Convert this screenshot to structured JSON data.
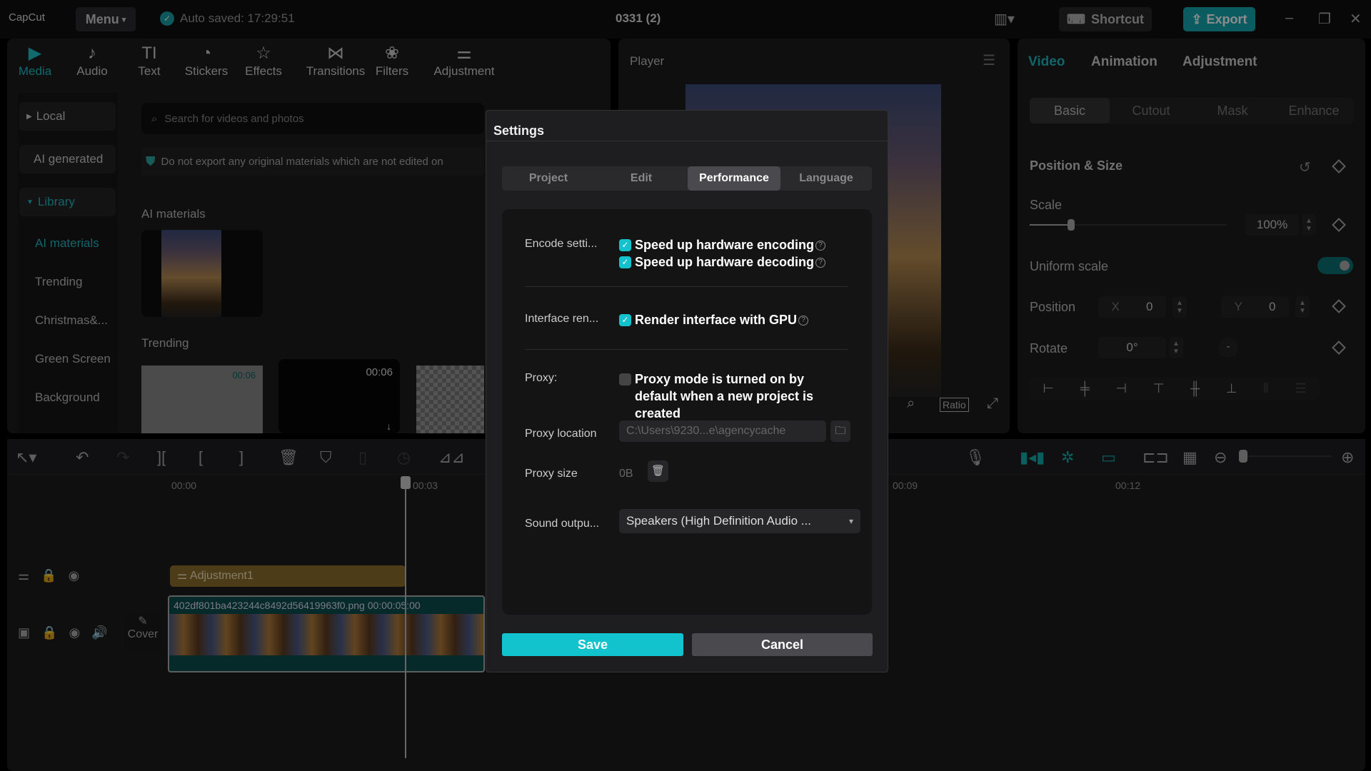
{
  "topbar": {
    "logo": "CapCut",
    "menu": "Menu",
    "autosave": "Auto saved: 17:29:51",
    "project_title": "0331 (2)",
    "shortcut": "Shortcut",
    "export": "Export"
  },
  "toolbar": {
    "tabs": [
      {
        "label": "Media",
        "icon": "▶"
      },
      {
        "label": "Audio",
        "icon": "♪"
      },
      {
        "label": "Text",
        "icon": "TI"
      },
      {
        "label": "Stickers",
        "icon": "◔"
      },
      {
        "label": "Effects",
        "icon": "☆"
      },
      {
        "label": "Transitions",
        "icon": "⋈"
      },
      {
        "label": "Filters",
        "icon": "❀"
      },
      {
        "label": "Adjustment",
        "icon": "⚌"
      }
    ]
  },
  "sidebar": {
    "local": "Local",
    "ai_generated": "AI generated",
    "library": "Library",
    "items": [
      "AI materials",
      "Trending",
      "Christmas&...",
      "Green Screen",
      "Background"
    ]
  },
  "media": {
    "search_placeholder": "Search for videos and photos",
    "notice": "Do not export any original materials which are not edited on",
    "ai_section": "AI materials",
    "trending_section": "Trending",
    "thumb1_duration": "00:06",
    "thumb2_duration": "00:06"
  },
  "player": {
    "title": "Player",
    "ratio": "Ratio"
  },
  "right_panel": {
    "tabs": [
      "Video",
      "Animation",
      "Adjustment"
    ],
    "subtabs": [
      "Basic",
      "Cutout",
      "Mask",
      "Enhance"
    ],
    "section": "Position & Size",
    "scale_label": "Scale",
    "scale_value": "100%",
    "scale_percent": 100,
    "uniform_label": "Uniform scale",
    "uniform_on": true,
    "position_label": "Position",
    "x_label": "X",
    "x_value": "0",
    "y_label": "Y",
    "y_value": "0",
    "rotate_label": "Rotate",
    "rotate_value": "0°"
  },
  "timeline": {
    "ruler": [
      "00:00",
      "00:03",
      "00:09",
      "00:12"
    ],
    "adjustment_clip": "Adjustment1",
    "video_clip": "402df801ba423244c8492d56419963f0.png",
    "video_duration": "00:00:05:00",
    "cover": "Cover"
  },
  "settings": {
    "title": "Settings",
    "tabs": [
      "Project",
      "Edit",
      "Performance",
      "Language"
    ],
    "active_tab": "Performance",
    "encode_label": "Encode setti...",
    "hw_encoding": "Speed up hardware encoding",
    "hw_encoding_checked": true,
    "hw_decoding": "Speed up hardware decoding",
    "hw_decoding_checked": true,
    "interface_label": "Interface ren...",
    "gpu_render": "Render interface with GPU",
    "gpu_render_checked": true,
    "proxy_label": "Proxy:",
    "proxy_mode": "Proxy mode is turned on by default when a new project is created",
    "proxy_mode_checked": false,
    "proxy_location_label": "Proxy location",
    "proxy_location_value": "C:\\Users\\9230...e\\agencycache",
    "proxy_size_label": "Proxy size",
    "proxy_size_value": "0B",
    "sound_label": "Sound outpu...",
    "sound_value": "Speakers (High Definition Audio ...",
    "save": "Save",
    "cancel": "Cancel"
  },
  "colors": {
    "accent": "#12c3cd",
    "export": "#12a8ae",
    "adjustment_clip": "#8a6d2a",
    "video_clip": "#0b4a4c"
  }
}
